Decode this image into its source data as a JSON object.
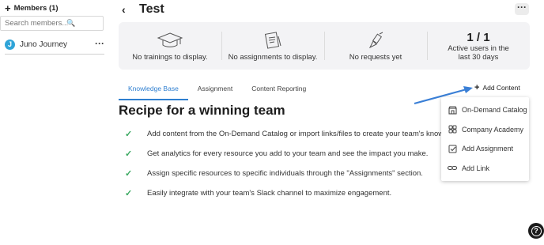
{
  "sidebar": {
    "members_label": "Members (1)",
    "search_placeholder": "Search members...",
    "members": [
      {
        "initial": "J",
        "name": "Juno Journey"
      }
    ]
  },
  "header": {
    "title": "Test"
  },
  "stats": {
    "trainings": "No trainings to display.",
    "assignments": "No assignments to display.",
    "requests": "No requests yet",
    "active_users_value": "1 / 1",
    "active_users_label": "Active users in the last 30 days"
  },
  "tabs": [
    {
      "label": "Knowledge Base",
      "active": true
    },
    {
      "label": "Assignment",
      "active": false
    },
    {
      "label": "Content Reporting",
      "active": false
    }
  ],
  "add_content_label": "Add Content",
  "knowledge_base": {
    "title": "Recipe for a winning team",
    "features": [
      "Add content from the On-Demand Catalog or import links/files to create your team's knowledge base.",
      "Get analytics for every resource you add to your team and see the impact you make.",
      "Assign specific resources to specific individuals through the \"Assignments\" section.",
      "Easily integrate with your team's Slack channel to maximize engagement."
    ]
  },
  "dropdown": {
    "items": [
      {
        "label": "On-Demand Catalog",
        "icon": "catalog-icon"
      },
      {
        "label": "Company Academy",
        "icon": "academy-icon"
      },
      {
        "label": "Add Assignment",
        "icon": "assignment-icon"
      },
      {
        "label": "Add Link",
        "icon": "link-icon"
      }
    ]
  },
  "colors": {
    "accent": "#2f7fd0",
    "check": "#3aa860",
    "annotation_arrow": "#3a7fd6"
  }
}
